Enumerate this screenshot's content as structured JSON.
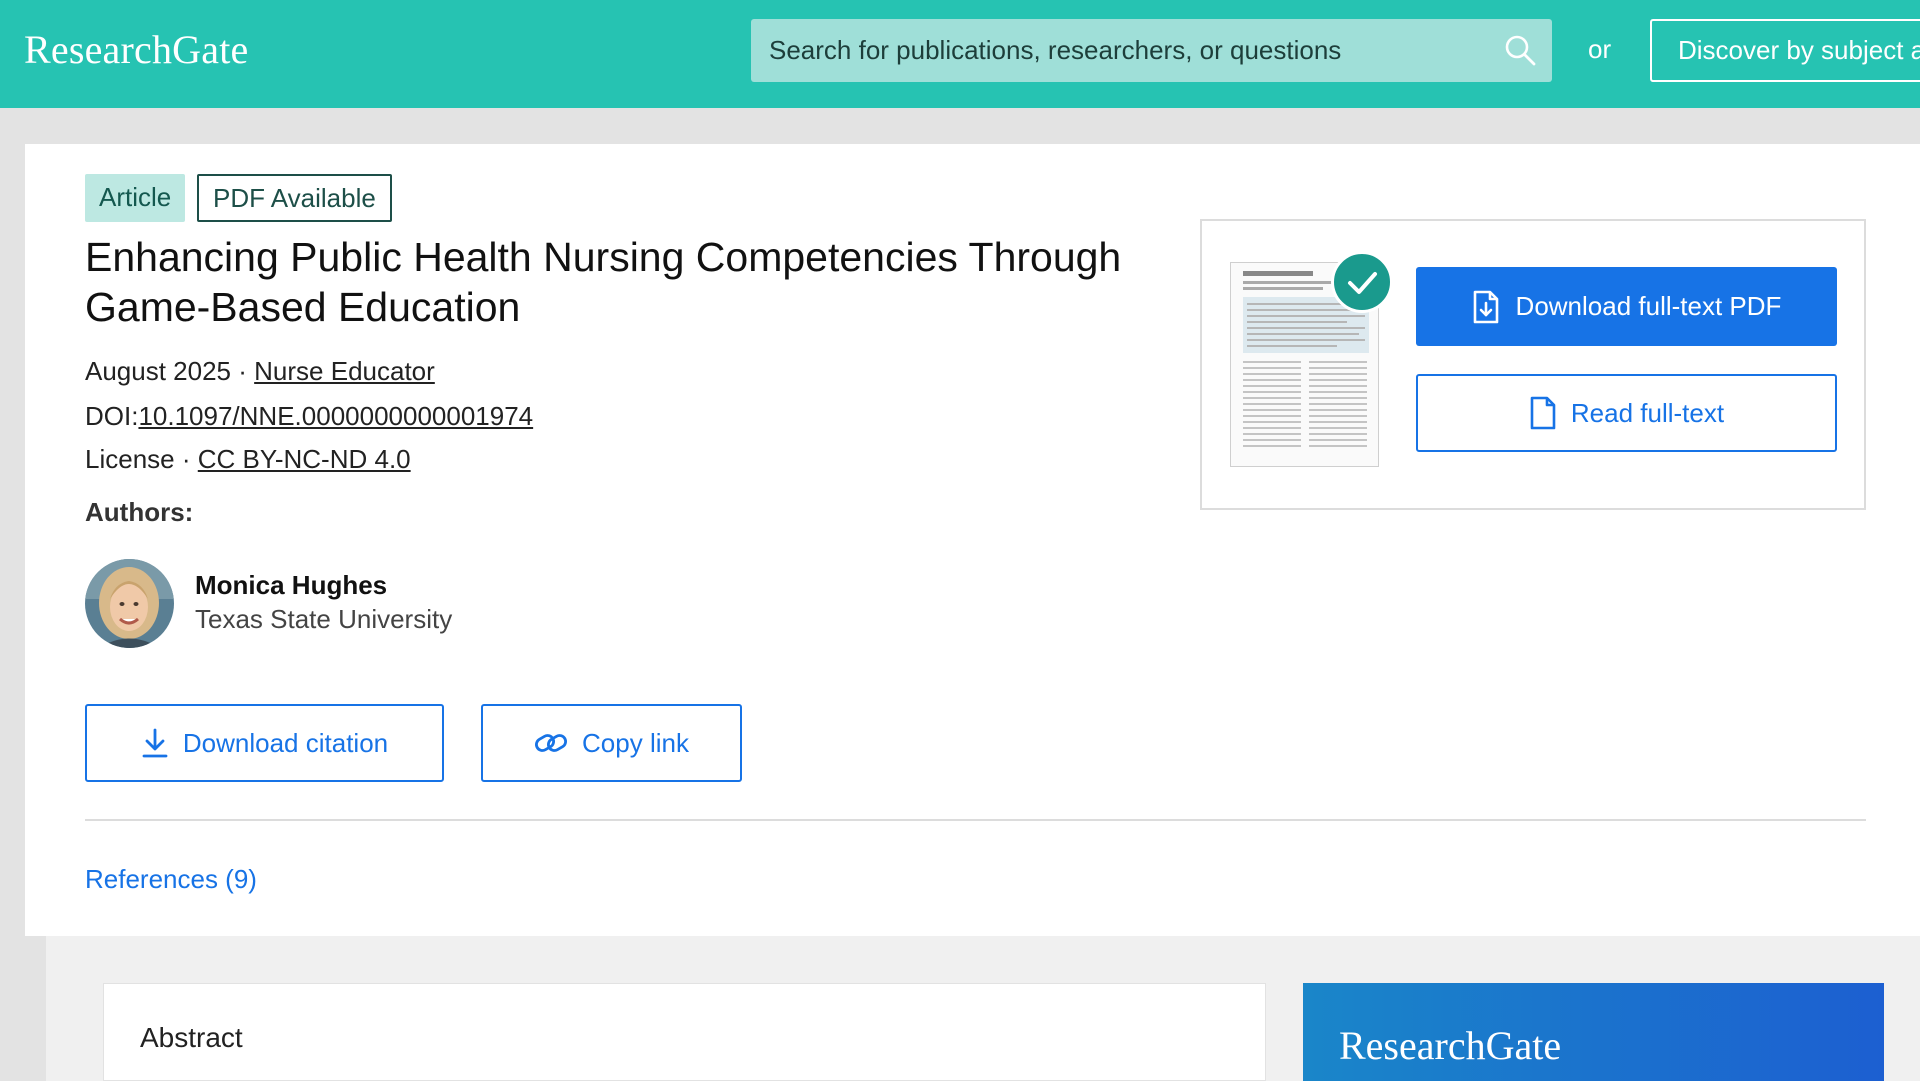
{
  "header": {
    "logo": "ResearchGate",
    "search_placeholder": "Search for publications, researchers, or questions",
    "or_text": "or",
    "discover_label": "Discover by subject area"
  },
  "article": {
    "badges": [
      "Article",
      "PDF Available"
    ],
    "title": "Enhancing Public Health Nursing Competencies Through Game-Based Education",
    "date": "August 2025",
    "separator": "·",
    "journal": "Nurse Educator",
    "doi_label": "DOI:",
    "doi": "10.1097/NNE.0000000000001974",
    "license_label": "License",
    "license": "CC BY-NC-ND 4.0",
    "authors_label": "Authors:",
    "author": {
      "name": "Monica Hughes",
      "institution": "Texas State University"
    },
    "download_citation": "Download citation",
    "copy_link": "Copy link",
    "references": "References (9)"
  },
  "pdf_panel": {
    "download_pdf": "Download full-text PDF",
    "read_full_text": "Read full-text"
  },
  "lower": {
    "abstract_title": "Abstract",
    "promo_logo": "ResearchGate"
  },
  "colors": {
    "brand_teal": "#26c3b2",
    "link_blue": "#1773e6",
    "check_green": "#1a9a8d"
  }
}
